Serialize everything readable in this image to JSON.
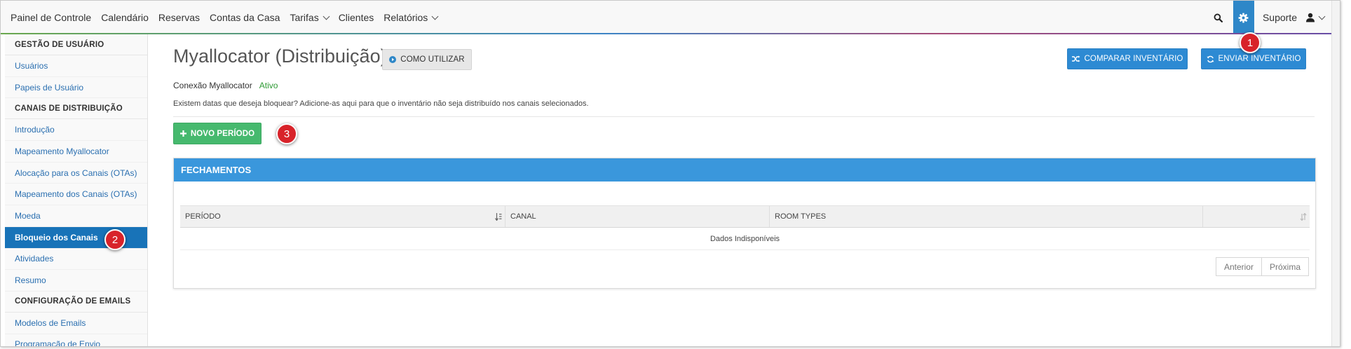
{
  "topnav": {
    "items": [
      {
        "label": "Painel de Controle"
      },
      {
        "label": "Calendário"
      },
      {
        "label": "Reservas"
      },
      {
        "label": "Contas da Casa"
      },
      {
        "label": "Tarifas",
        "dropdown": true
      },
      {
        "label": "Clientes"
      },
      {
        "label": "Relatórios",
        "dropdown": true
      }
    ],
    "support_label": "Suporte",
    "icons": {
      "search": "search-icon",
      "settings": "gear-icon",
      "user": "user-icon"
    },
    "accent_color": "#2e87c8"
  },
  "sidebar": {
    "sections": [
      {
        "header": "GESTÃO DE USUÁRIO",
        "items": [
          "Usuários",
          "Papeis de Usuário"
        ]
      },
      {
        "header": "CANAIS DE DISTRIBUIÇÃO",
        "items": [
          "Introdução",
          "Mapeamento Myallocator",
          "Alocação para os Canais (OTAs)",
          "Mapeamento dos Canais (OTAs)",
          "Moeda",
          "Bloqueio dos Canais",
          "Atividades",
          "Resumo"
        ]
      },
      {
        "header": "CONFIGURAÇÃO DE EMAILS",
        "items": [
          "Modelos de Emails",
          "Programação de Envio"
        ]
      }
    ],
    "active_item": "Bloqueio dos Canais",
    "active_color": "#1873b8"
  },
  "main": {
    "title": "Myallocator (Distribuição)",
    "how_to_label": "COMO UTILIZAR",
    "compare_label": "COMPARAR INVENTÁRIO",
    "send_label": "ENVIAR INVENTÁRIO",
    "connection_label": "Conexão Myallocator",
    "connection_status": "Ativo",
    "help_text": "Existem datas que deseja bloquear? Adicione-as aqui para que o inventário não seja distribuído nos canais selecionados.",
    "new_period_label": "NOVO PERÍODO",
    "panel": {
      "title": "FECHAMENTOS",
      "columns": [
        "PERÍODO",
        "CANAL",
        "ROOM TYPES",
        ""
      ],
      "empty_text": "Dados Indisponíveis",
      "pager": {
        "prev": "Anterior",
        "next": "Próxima"
      }
    },
    "colors": {
      "blue_button": "#2d8ad3",
      "green_button": "#46b96e",
      "panel_header": "#3a97dc",
      "status_active": "#2e9a34"
    }
  },
  "callouts": [
    "1",
    "2",
    "3"
  ]
}
